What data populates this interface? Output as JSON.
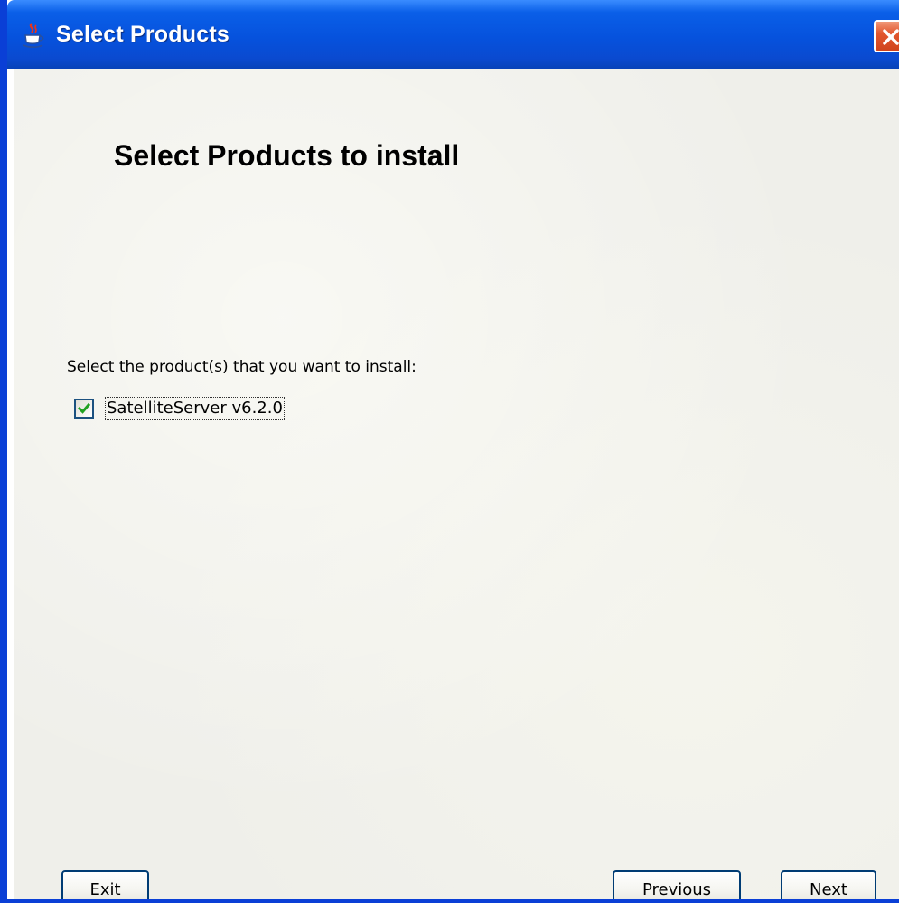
{
  "window": {
    "title": "Select Products",
    "title_icon": "java-cup-icon",
    "close_icon": "close-icon"
  },
  "main": {
    "heading": "Select Products to install",
    "prompt": "Select the product(s) that you want to install:",
    "products": [
      {
        "label": "SatelliteServer v6.2.0",
        "checked": true
      }
    ]
  },
  "buttons": {
    "exit_label": "Exit",
    "previous_label": "Previous",
    "next_label": "Next"
  },
  "colors": {
    "titlebar": "#0652dd",
    "window_border": "#0a3fd6",
    "close_button": "#d0441d",
    "content_background": "#efefea",
    "checkmark": "#21a121",
    "button_border": "#003c74"
  }
}
